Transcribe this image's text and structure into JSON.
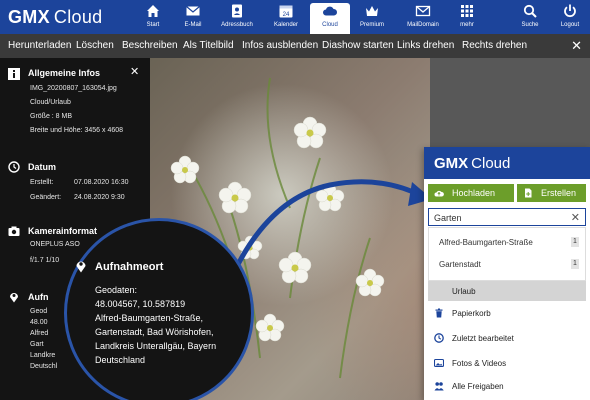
{
  "brand": {
    "logo_bold": "GMX",
    "logo_light": "Cloud"
  },
  "nav": {
    "items": [
      {
        "label": "Start",
        "icon": "home-icon"
      },
      {
        "label": "E-Mail",
        "icon": "mail-icon"
      },
      {
        "label": "Adressbuch",
        "icon": "addressbook-icon"
      },
      {
        "label": "Kalender",
        "icon": "calendar-icon",
        "badge": "24"
      },
      {
        "label": "Cloud",
        "icon": "cloud-icon",
        "active": true
      },
      {
        "label": "Premium",
        "icon": "crown-icon"
      },
      {
        "label": "MailDomain",
        "icon": "maildomain-icon"
      },
      {
        "label": "mehr",
        "icon": "grid-icon"
      }
    ],
    "right": [
      {
        "label": "Suche",
        "icon": "search-icon"
      },
      {
        "label": "Logout",
        "icon": "power-icon"
      }
    ]
  },
  "toolbar": {
    "buttons": [
      "Herunterladen",
      "Löschen",
      "Beschreiben",
      "Als Titelbild",
      "Infos ausblenden",
      "Diashow starten",
      "Links drehen",
      "Rechts drehen"
    ],
    "close": "✕"
  },
  "info": {
    "general_title": "Allgemeine Infos",
    "file_name": "IMG_20200807_163054.jpg",
    "path": "Cloud/Urlaub",
    "size": "Größe : 8 MB",
    "dimensions": "Breite und Höhe: 3456 x 4608",
    "date_title": "Datum",
    "created_label": "Erstellt:",
    "created_value": "07.08.2020 16:30",
    "modified_label": "Geändert:",
    "modified_value": "24.08.2020 9:30",
    "camera_title": "Kamerainformat",
    "camera_model": "ONEPLUS ASO",
    "camera_settings": "f/1.7 1/10",
    "location_title_partial": "Aufn",
    "location_partial_lines": [
      "Geod",
      "48.00",
      "Alfred",
      "Gart",
      "Landkre",
      "Deutschl"
    ],
    "close": "✕"
  },
  "magnifier": {
    "title": "Aufnahmeort",
    "lines": [
      "Geodaten:",
      "48.004567, 10.587819",
      "Alfred-Baumgarten-Straße,",
      "Gartenstadt, Bad Wörishofen,",
      "Landkreis Unterallgäu, Bayern",
      "Deutschland"
    ]
  },
  "sidebar": {
    "logo_bold": "GMX",
    "logo_light": "Cloud",
    "upload_label": "Hochladen",
    "create_label": "Erstellen",
    "search_value": "Garten",
    "suggestions": [
      {
        "label": "Alfred-Baumgarten-Straße",
        "count": "1"
      },
      {
        "label": "Gartenstadt",
        "count": "1"
      }
    ],
    "items": [
      {
        "label": "Urlaub",
        "icon": "folder-icon",
        "active": true
      },
      {
        "label": "Papierkorb",
        "icon": "trash-icon"
      },
      {
        "label": "Zuletzt bearbeitet",
        "icon": "clock-icon"
      },
      {
        "label": "Fotos & Videos",
        "icon": "photos-icon"
      },
      {
        "label": "Alle Freigaben",
        "icon": "shares-icon"
      }
    ]
  },
  "colors": {
    "brand_blue": "#1c449b",
    "green": "#6c9e2a",
    "dark_panel": "#141414",
    "toolbar": "#3a3a3a"
  }
}
